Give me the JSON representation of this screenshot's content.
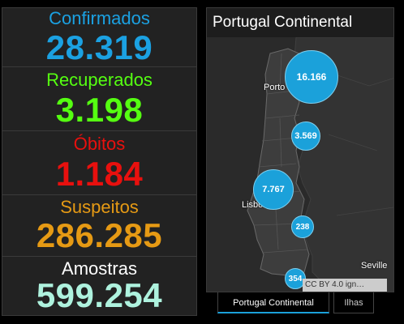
{
  "stats": {
    "confirmed": {
      "label": "Confirmados",
      "value": "28.319",
      "color": "#1ba1e2"
    },
    "recovered": {
      "label": "Recuperados",
      "value": "3.198",
      "color": "#55ff11"
    },
    "deaths": {
      "label": "Óbitos",
      "value": "1.184",
      "color": "#e8100e"
    },
    "suspects": {
      "label": "Suspeitos",
      "value": "286.285",
      "color": "#e69a14"
    },
    "samples": {
      "label": "Amostras",
      "value": "599.254",
      "color": "#aef2de"
    }
  },
  "map": {
    "title": "Portugal Continental",
    "attribution": "CC BY 4.0 ign…",
    "cities": {
      "porto": "Porto",
      "lisbon": "Lisbon",
      "seville": "Seville"
    },
    "bubbles": {
      "north": "16.166",
      "centre": "3.569",
      "lisbon": "7.767",
      "alentejo": "238",
      "algarve": "354"
    }
  },
  "tabs": {
    "continental": "Portugal Continental",
    "islands": "Ilhas"
  }
}
